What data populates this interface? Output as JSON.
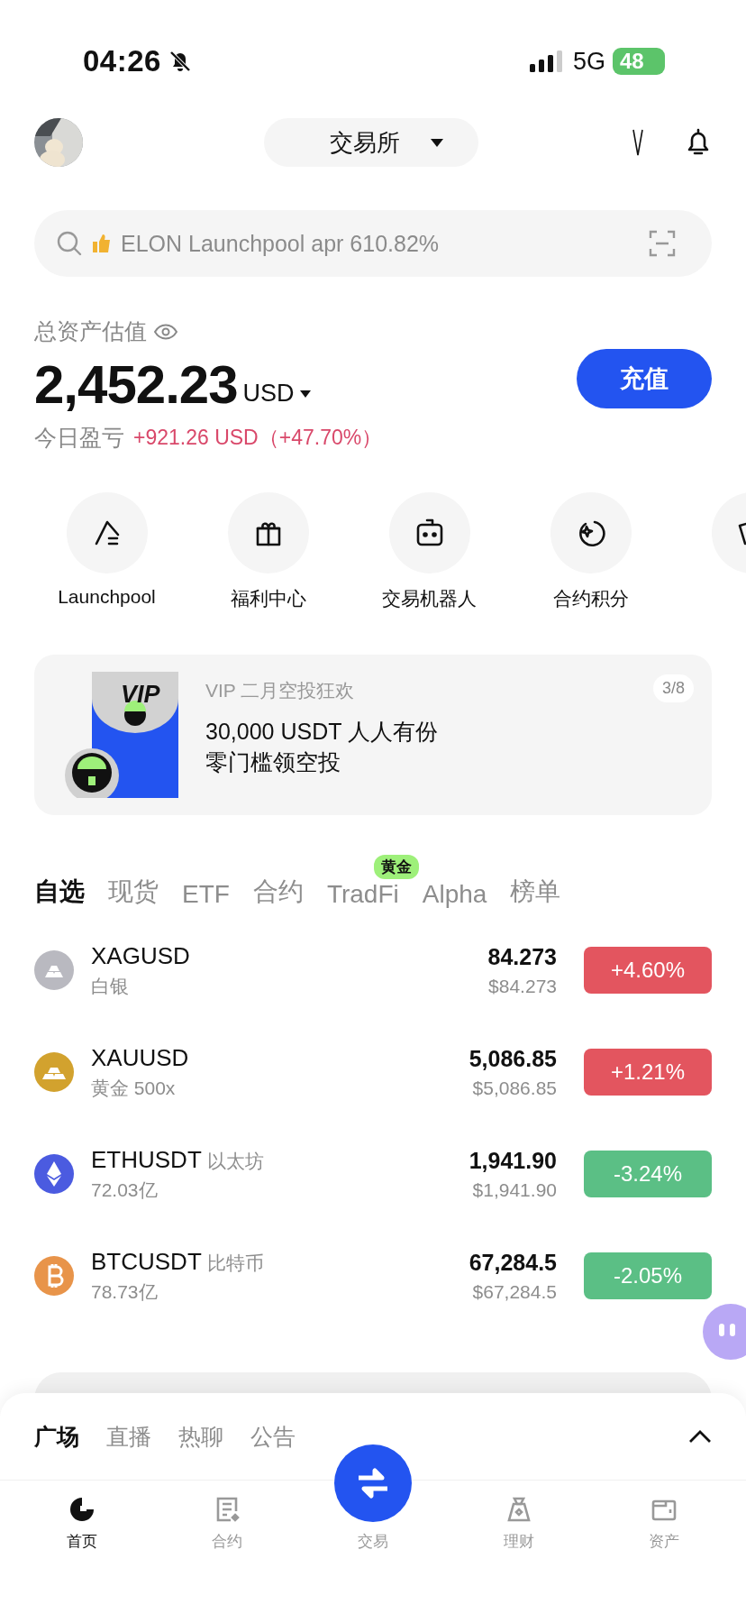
{
  "status_bar": {
    "time": "04:26",
    "silent": true,
    "network": "5G",
    "battery": "48"
  },
  "header": {
    "exchange": "交易所"
  },
  "search": {
    "placeholder": "ELON Launchpool apr 610.82%"
  },
  "assets": {
    "label": "总资产估值",
    "total": "2,452.23",
    "currency": "USD",
    "pnl_label": "今日盈亏",
    "pnl": "+921.26 USD（+47.70%）",
    "deposit": "充值"
  },
  "shortcuts": [
    {
      "kind": "pick",
      "label": "Launchpool"
    },
    {
      "kind": "gift",
      "label": "福利中心"
    },
    {
      "kind": "robot",
      "label": "交易机器人"
    },
    {
      "kind": "points",
      "label": "合约积分"
    },
    {
      "kind": "cards"
    }
  ],
  "banner": {
    "logo": "VIP",
    "subtitle": "VIP 二月空投狂欢",
    "title": "30,000 USDT 人人有份",
    "line2": "零门槛领空投",
    "page": "3/8"
  },
  "market_tabs": [
    {
      "label": "自选",
      "selected": true
    },
    {
      "label": "现货",
      "selected": false
    },
    {
      "label": "ETF",
      "selected": false
    },
    {
      "label": "合约",
      "selected": false
    },
    {
      "label": "TradFi",
      "selected": false,
      "badge": "黄金"
    },
    {
      "label": "Alpha",
      "selected": false
    },
    {
      "label": "榜单",
      "selected": false
    }
  ],
  "rows": [
    {
      "kind": "silver",
      "symbol": "XAGUSD",
      "sub": "白银",
      "price": "84.273",
      "usd": "$84.273",
      "change": "+4.60%",
      "color": "#e3555f"
    },
    {
      "kind": "gold",
      "symbol": "XAUUSD",
      "sub": "黄金 500x",
      "price": "5,086.85",
      "usd": "$5,086.85",
      "change": "+1.21%",
      "color": "#e3555f"
    },
    {
      "kind": "eth",
      "symbol": "ETHUSDT",
      "name": "以太坊",
      "sub": "72.03亿",
      "price": "1,941.90",
      "usd": "$1,941.90",
      "change": "-3.24%",
      "color": "#5bbf85"
    },
    {
      "kind": "btc",
      "symbol": "BTCUSDT",
      "name": "比特币",
      "sub": "78.73亿",
      "price": "67,284.5",
      "usd": "$67,284.5",
      "change": "-2.05%",
      "color": "#5bbf85"
    }
  ],
  "feed_tabs": [
    {
      "label": "广场",
      "selected": true
    },
    {
      "label": "直播",
      "selected": false
    },
    {
      "label": "热聊",
      "selected": false
    },
    {
      "label": "公告",
      "selected": false
    }
  ],
  "nav": [
    {
      "kind": "home",
      "label": "首页",
      "selected": true
    },
    {
      "kind": "futures",
      "label": "合约",
      "selected": false
    },
    {
      "kind": "trade",
      "label": "交易",
      "selected": false
    },
    {
      "kind": "earn",
      "label": "理财",
      "selected": false
    },
    {
      "kind": "assets",
      "label": "资产",
      "selected": false
    }
  ]
}
